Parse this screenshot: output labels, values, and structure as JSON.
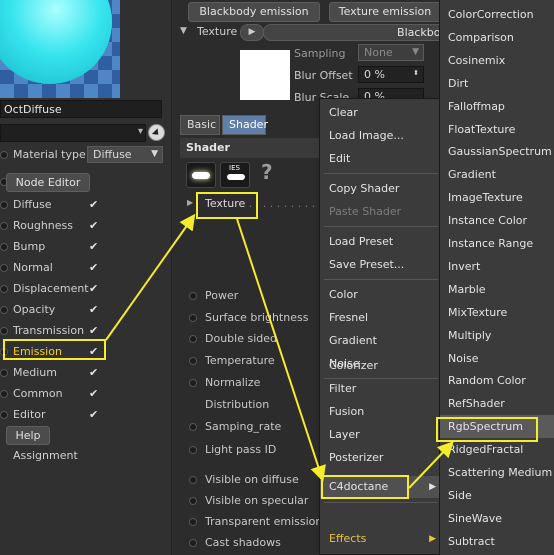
{
  "material": {
    "name": "OctDiffuse",
    "type_label": "Material type",
    "type_value": "Diffuse"
  },
  "buttons": {
    "node_editor": "Node Editor",
    "help": "Help"
  },
  "left_channels": [
    {
      "label": "Diffuse",
      "checked": "✔"
    },
    {
      "label": "Roughness",
      "checked": "✔"
    },
    {
      "label": "Bump",
      "checked": "✔"
    },
    {
      "label": "Normal",
      "checked": "✔"
    },
    {
      "label": "Displacement",
      "checked": "✔"
    },
    {
      "label": "Opacity",
      "checked": "✔"
    },
    {
      "label": "Transmission",
      "checked": "✔"
    },
    {
      "label": "Emission",
      "checked": "✔"
    },
    {
      "label": "Medium",
      "checked": "✔"
    },
    {
      "label": "Common",
      "checked": "✔"
    },
    {
      "label": "Editor",
      "checked": "✔"
    }
  ],
  "assignment_label": "Assignment",
  "top": {
    "blackbody_btn": "Blackbody emission",
    "texture_btn": "Texture emission",
    "texture_label": "Texture",
    "blackbody_field": "Blackbody",
    "sampling_label": "Sampling",
    "sampling_value": "None",
    "blur_offset_label": "Blur Offset",
    "blur_offset_value": "0 %",
    "blur_scale_label": "Blur Scale",
    "blur_scale_value": "0 %"
  },
  "tabs": {
    "basic": "Basic",
    "shader": "Shader"
  },
  "shader": {
    "section": "Shader",
    "ies_label": "IES",
    "texture_label": "Texture",
    "params": [
      "Power",
      "Surface brightness",
      "Double sided",
      "Temperature",
      "Normalize",
      "Distribution",
      "Samping_rate",
      "Light pass ID",
      "Visible on diffuse",
      "Visible on specular",
      "Transparent emission",
      "Cast shadows"
    ]
  },
  "menu1": {
    "items": [
      "Clear",
      "Load Image...",
      "Edit",
      "Copy Shader",
      "Paste Shader",
      "Load Preset",
      "Save Preset...",
      "Color",
      "Fresnel",
      "Gradient",
      "Noise",
      "Colorizer",
      "Filter",
      "Fusion",
      "Layer",
      "Posterizer",
      "C4doctane",
      "Effects"
    ]
  },
  "menu2": {
    "items": [
      "ColorCorrection",
      "Comparison",
      "Cosinemix",
      "Dirt",
      "Falloffmap",
      "FloatTexture",
      "GaussianSpectrum",
      "Gradient",
      "ImageTexture",
      "Instance Color",
      "Instance Range",
      "Invert",
      "Marble",
      "MixTexture",
      "Multiply",
      "Noise",
      "Random Color",
      "RefShader",
      "RgbSpectrum",
      "RidgedFractal",
      "Scattering Medium",
      "Side",
      "SineWave",
      "Subtract"
    ],
    "selected": "RgbSpectrum"
  },
  "colors": {
    "highlight": "#f5ec2a",
    "active_tab": "#5f7fa8",
    "effects_text": "#e8c440"
  }
}
